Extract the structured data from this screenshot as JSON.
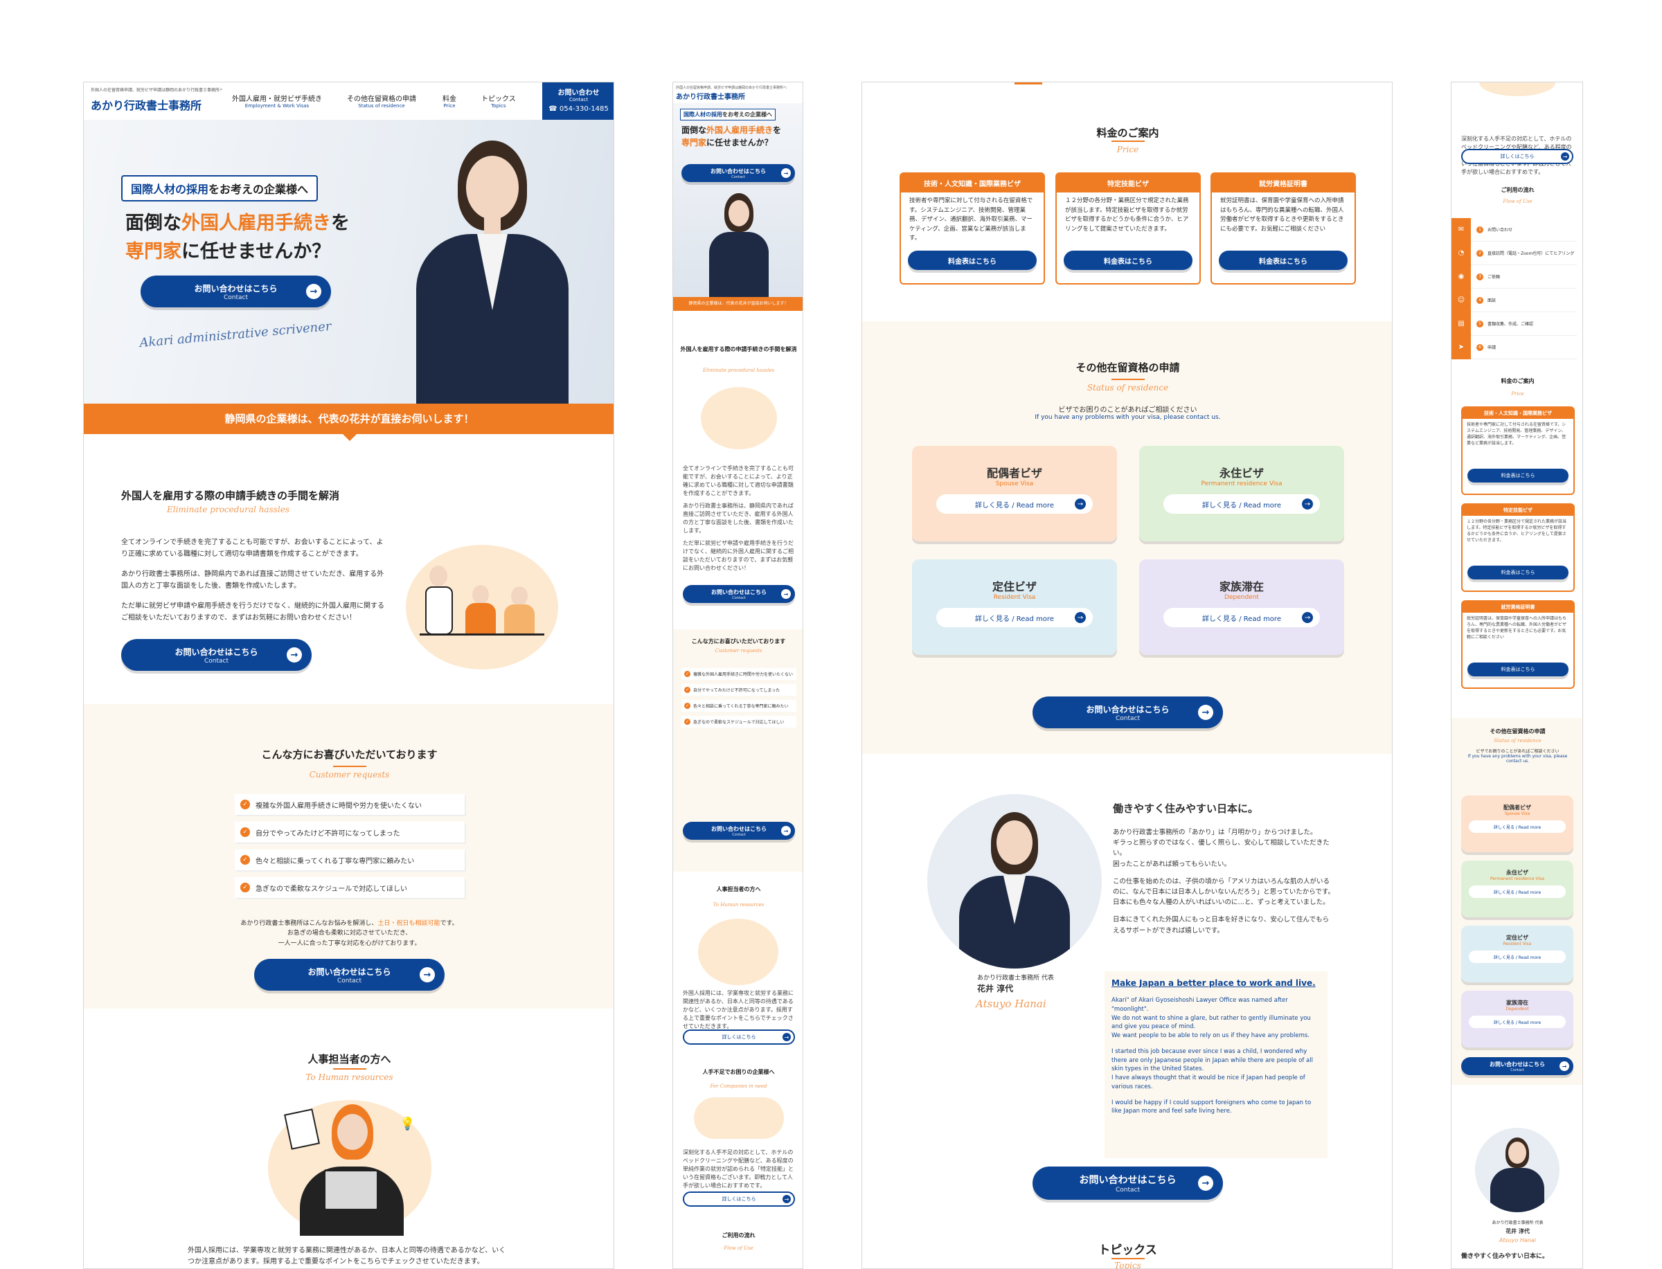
{
  "colors": {
    "navy": "#0d4596",
    "orange": "#ef7b22",
    "cream": "#fdf8ef"
  },
  "header": {
    "tagline": "外国人の在留資格申請、就労ビザ申請は静岡のあかり行政書士事務所へ",
    "logo": "あかり行政書士事務所",
    "nav": [
      {
        "label": "外国人雇用・就労ビザ手続き",
        "sub": "Employment & Work Visas"
      },
      {
        "label": "その他在留資格の申請",
        "sub": "Status of residence"
      },
      {
        "label": "料金",
        "sub": "Price"
      },
      {
        "label": "トピックス",
        "sub": "Topics"
      }
    ],
    "contact_label": "お問い合わせ",
    "contact_sub": "Contact",
    "phone": "054-330-1485"
  },
  "hero": {
    "badge_pre": "国際人材の採用",
    "badge_post": "をお考えの企業様へ",
    "line1_pre": "面倒な",
    "line1_accent": "外国人雇用手続き",
    "line1_post": "を",
    "line2_accent": "専門家",
    "line2_post": "に任せませんか？",
    "signature": "Akari administrative scrivener",
    "banner": "静岡県の企業様は、代表の花井が直接お伺いします！"
  },
  "cta": {
    "label": "お問い合わせはこちら",
    "sub": "Contact"
  },
  "procedure": {
    "title": "外国人を雇用する際の申請手続きの手間を解消",
    "subtitle": "Eliminate procedural hassles",
    "p1": "全てオンラインで手続きを完了することも可能ですが、お会いすることによって、より正確に求めている職種に対して適切な申請書類を作成することができます。",
    "p2": "あかり行政書士事務所は、静岡県内であれば直接ご訪問させていただき、雇用する外国人の方と丁寧な面談をした後、書類を作成いたします。",
    "p3": "ただ単に就労ビザ申請や雇用手続きを行うだけでなく、継続的に外国人雇用に関するご相談をいただいておりますので、まずはお気軽にお問い合わせください！"
  },
  "customers": {
    "title": "こんな方にお喜びいただいております",
    "subtitle": "Customer requests",
    "items": [
      "複雑な外国人雇用手続きに時間や労力を使いたくない",
      "自分でやってみたけど不許可になってしまった",
      "色々と相談に乗ってくれる丁寧な専門家に頼みたい",
      "急ぎなので柔軟なスケジュールで対応してほしい"
    ],
    "note_pre": "あかり行政書士事務所はこんなお悩みを解消し、",
    "note_accent": "土日・祝日も相談可能",
    "note_post": "です。",
    "note2": "お急ぎの場合も柔軟に対応させていただき、",
    "note3": "一人一人に合った丁寧な対応を心がけております。"
  },
  "hr": {
    "title": "人事担当者の方へ",
    "subtitle": "To Human resources",
    "text": "外国人採用には、学業専攻と就労する業務に関連性があるか、日本人と同等の待遇であるかなど、いくつか注意点があります。採用する上で重要なポイントをこちらでチェックさせていただきます。",
    "more": "詳しくはこちら"
  },
  "companies": {
    "title": "人手不足でお困りの企業様へ",
    "subtitle": "For Companies in need",
    "text": "深刻化する人手不足の対応として、ホテルのベッドクリーニングや配膳など、ある程度の単純作業の就労が認められる「特定技能」という在留資格もございます。即戦力として人手が欲しい場合におすすめです。"
  },
  "flow": {
    "title": "ご利用の流れ",
    "subtitle": "Flow of Use",
    "steps": [
      "お問い合わせ",
      "直接訪問（電話・Zoom也可）にてヒアリング",
      "ご依頼",
      "面談",
      "書類収集、作成、ご確認",
      "申請"
    ]
  },
  "price": {
    "title": "料金のご案内",
    "subtitle": "Price",
    "button": "料金表はこちら",
    "cards": [
      {
        "title": "技術・人文知識・国際業務ビザ",
        "text": "技術者や専門家に対して付与される在留資格です。システムエンジニア、技術開発、管理業務、デザイン、通訳翻訳、海外取引業務、マーケティング、企画、営業など業務が該当します。"
      },
      {
        "title": "特定技能ビザ",
        "text": "１２分野の各分野・業務区分で規定された業務が該当します。特定技能ビザを取得するか就労ビザを取得するかどうかも条件に合うか、ヒアリングをして提案させていただきます。"
      },
      {
        "title": "就労資格証明書",
        "text": "就労証明書は、保育園や学童保育への入所申請はもちろん、専門的な異業種への転職、外国人労働者がビザを取得するときや更新をするときにも必要です。お気軽にご相談ください"
      }
    ]
  },
  "residence": {
    "title": "その他在留資格の申請",
    "subtitle": "Status of residence",
    "lead_jp": "ビザでお困りのことがあればご相談ください",
    "lead_en": "If you have any problems with your visa, please contact us.",
    "read_more": "詳しく見る / Read more",
    "cards": [
      {
        "jp": "配偶者ビザ",
        "en": "Spouse Visa",
        "color": "#fde1cc"
      },
      {
        "jp": "永住ビザ",
        "en": "Permanent residence Visa",
        "color": "#dff0d8"
      },
      {
        "jp": "定住ビザ",
        "en": "Resident Visa",
        "color": "#dcedf3"
      },
      {
        "jp": "家族滞在",
        "en": "Dependent",
        "color": "#e9e3f6"
      }
    ]
  },
  "profile": {
    "heading": "働きやすく住みやすい日本に。",
    "jp1": "あかり行政書士事務所の「あかり」は「月明かり」からつけました。",
    "jp2": "ギラっと照らすのではなく、優しく照らし、安心して相談していただきたい。",
    "jp3": "困ったことがあれば頼ってもらいたい。",
    "jp4": "この仕事を始めたのは、子供の頃から「アメリカはいろんな肌の人がいるのに、なんで日本には日本人しかいないんだろう」と思っていたからです。",
    "jp5": "日本にも色々な人種の人がいればいいのに…と、ずっと考えていました。",
    "jp6": "日本にきてくれた外国人にもっと日本を好きになり、安心して住んでもらえるサポートができれば嬉しいです。",
    "role": "あかり行政書士事務所 代表",
    "name": "花井 淳代",
    "name_sig": "Atsuyo Hanai",
    "en_heading": "Make Japan a better place to work and live.",
    "en1": "Akari\" of Akari Gyoseishoshi Lawyer Office was named after \"moonlight\".",
    "en2": "We do not want to shine a glare, but rather to gently illuminate you and give you peace of mind.",
    "en3": "We want people to be able to rely on us if they have any problems.",
    "en4": "I started this job because ever since I was a child, I wondered why there are only Japanese people in Japan while there are people of all skin types in the United States.",
    "en5": "I have always thought that it would be nice if Japan had people of various races.",
    "en6": "I would be happy if I could support foreigners who come to Japan to like Japan more and feel safe living here."
  },
  "topics": {
    "title": "トピックス",
    "subtitle": "Topics"
  }
}
